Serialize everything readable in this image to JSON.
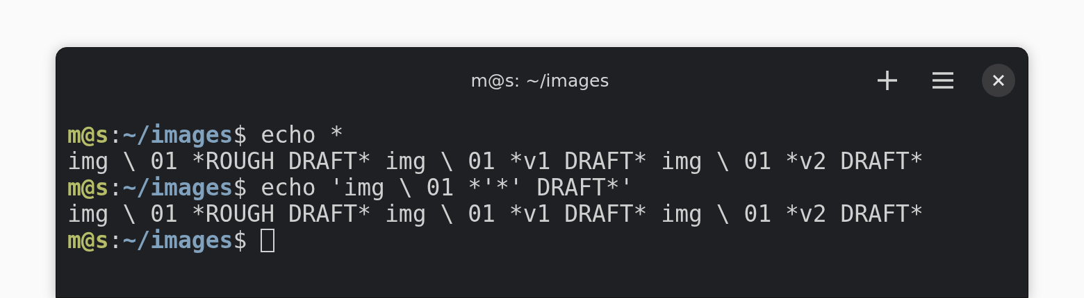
{
  "window": {
    "title": "m@s: ~/images"
  },
  "terminal": {
    "lines": [
      {
        "kind": "prompt",
        "user_host": "m@s",
        "separator": ":",
        "path": "~/images",
        "symbol": "$",
        "command": " echo *",
        "cursor": false
      },
      {
        "kind": "output",
        "text": "img \\ 01 *ROUGH DRAFT* img \\ 01 *v1 DRAFT* img \\ 01 *v2 DRAFT*"
      },
      {
        "kind": "prompt",
        "user_host": "m@s",
        "separator": ":",
        "path": "~/images",
        "symbol": "$",
        "command": " echo 'img \\ 01 *'*' DRAFT*'",
        "cursor": false
      },
      {
        "kind": "output",
        "text": "img \\ 01 *ROUGH DRAFT* img \\ 01 *v1 DRAFT* img \\ 01 *v2 DRAFT*"
      },
      {
        "kind": "prompt",
        "user_host": "m@s",
        "separator": ":",
        "path": "~/images",
        "symbol": "$",
        "cursor": true
      }
    ]
  }
}
